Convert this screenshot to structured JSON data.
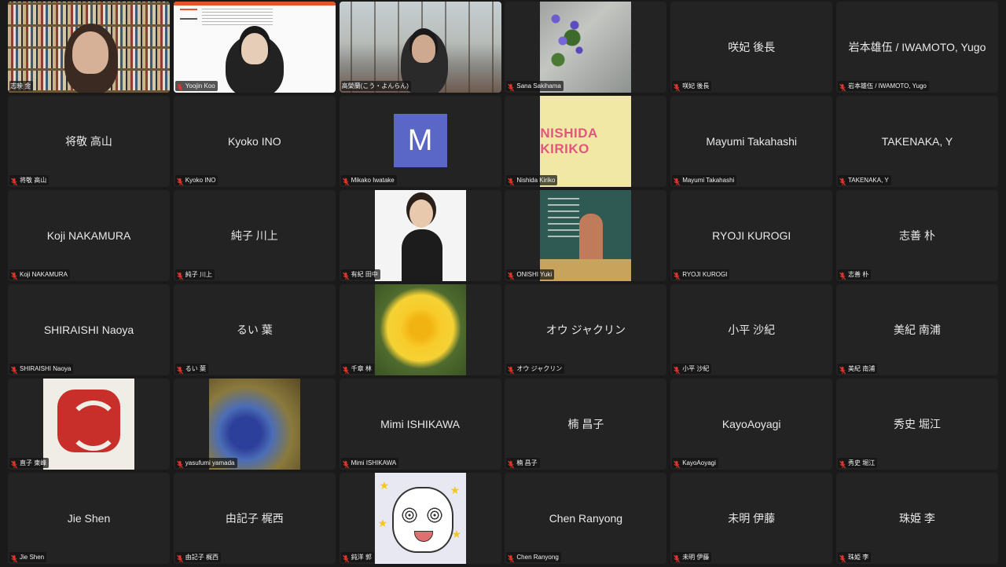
{
  "participants": [
    {
      "name": "志映 金",
      "show_center": false
    },
    {
      "name": "Yoojin Koo",
      "show_center": false
    },
    {
      "name": "高榮蘭(こう・よんらん)",
      "show_center": false
    },
    {
      "name": "Sana Sakihama",
      "show_center": false
    },
    {
      "name": "咲妃 後長",
      "show_center": true
    },
    {
      "name": "岩本雄伍 / IWAMOTO, Yugo",
      "show_center": true
    },
    {
      "name": "将敬 高山",
      "show_center": true
    },
    {
      "name": "Kyoko INO",
      "show_center": true
    },
    {
      "name": "Mikako Iwatake",
      "show_center": false,
      "avatar_letter": "M"
    },
    {
      "name": "Nishida Kiriko",
      "show_center": false,
      "image_text": "NISHIDA  KIRIKO"
    },
    {
      "name": "Mayumi Takahashi",
      "show_center": true
    },
    {
      "name": "TAKENAKA, Y",
      "show_center": true
    },
    {
      "name": "Koji NAKAMURA",
      "show_center": true
    },
    {
      "name": "純子 川上",
      "show_center": true
    },
    {
      "name": "有紀 田中",
      "show_center": false
    },
    {
      "name": "ONISHI Yuki",
      "show_center": false
    },
    {
      "name": "RYOJI KUROGI",
      "show_center": true
    },
    {
      "name": "志善 朴",
      "show_center": true
    },
    {
      "name": "SHIRAISHI Naoya",
      "show_center": true
    },
    {
      "name": "るい 葉",
      "show_center": true
    },
    {
      "name": "千章 林",
      "show_center": false
    },
    {
      "name": "オウ ジャクリン",
      "show_center": true
    },
    {
      "name": "小平 沙紀",
      "show_center": true
    },
    {
      "name": "美紀 南浦",
      "show_center": true
    },
    {
      "name": "直子 東峰",
      "show_center": false
    },
    {
      "name": "yasufumi yamada",
      "show_center": false
    },
    {
      "name": "Mimi ISHIKAWA",
      "show_center": true
    },
    {
      "name": "楠 昌子",
      "show_center": true
    },
    {
      "name": "KayoAoyagi",
      "show_center": true
    },
    {
      "name": "秀史 堀江",
      "show_center": true
    },
    {
      "name": "Jie Shen",
      "show_center": true
    },
    {
      "name": "由記子 梶西",
      "show_center": true
    },
    {
      "name": "鈍洋 郭",
      "show_center": false
    },
    {
      "name": "Chen Ranyong",
      "show_center": true
    },
    {
      "name": "未明 伊藤",
      "show_center": true
    },
    {
      "name": "珠姫 李",
      "show_center": true
    }
  ],
  "active_speaker_index": 0,
  "colors": {
    "active_border": "#7ed321",
    "muted_mic": "#e0372c",
    "tile_bg": "#232323",
    "page_bg": "#1a1a1a"
  },
  "icons": {
    "label_icon": "muted-mic-icon"
  }
}
